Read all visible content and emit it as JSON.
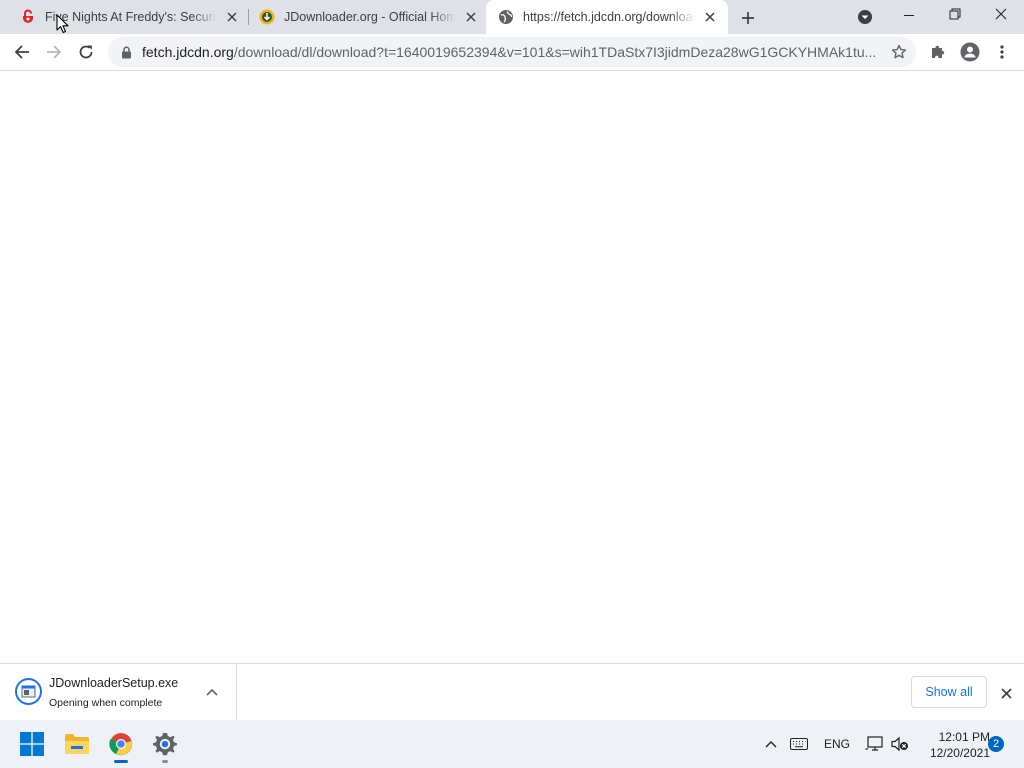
{
  "browser": {
    "tabs": [
      {
        "title": "Five Nights At Freddy's: Security",
        "icon": "fnaf-favicon-icon",
        "active": false
      },
      {
        "title": "JDownloader.org - Official Home",
        "icon": "jdownloader-favicon-icon",
        "active": false
      },
      {
        "title": "https://fetch.jdcdn.org/download",
        "icon": "globe-icon",
        "active": true
      }
    ],
    "address_bar": {
      "host": "fetch.jdcdn.org",
      "path": "/download/dl/download?t=1640019652394&v=101&s=wih1TDaStx7I3jidmDeza28wG1GCKYHMAk1tu..."
    }
  },
  "download_shelf": {
    "item": {
      "filename": "JDownloaderSetup.exe",
      "status": "Opening when complete"
    },
    "show_all_label": "Show all"
  },
  "taskbar": {
    "language": "ENG",
    "time": "12:01 PM",
    "date": "12/20/2021",
    "notification_count": "2",
    "accent_color": "#0067c0"
  }
}
